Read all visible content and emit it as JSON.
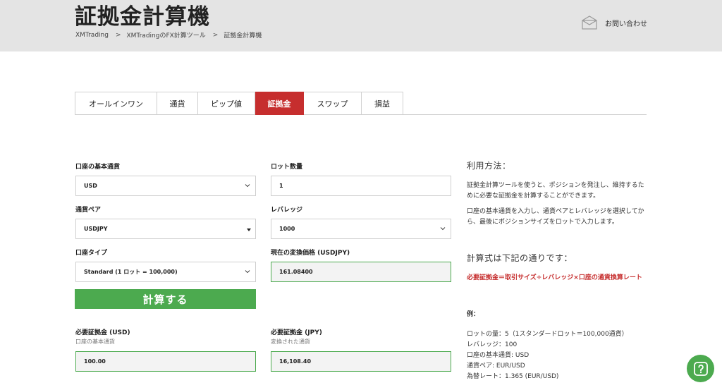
{
  "header": {
    "title": "証拠金計算機",
    "breadcrumb": [
      "XMTrading",
      "XMTradingのFX計算ツール",
      "証拠金計算機"
    ],
    "breadcrumb_separator": ">",
    "contact_label": "お問い合わせ",
    "contact_icon": "envelope-icon"
  },
  "tabs": [
    {
      "label": "オールインワン",
      "active": false
    },
    {
      "label": "通貨",
      "active": false
    },
    {
      "label": "ピップ値",
      "active": false
    },
    {
      "label": "証拠金",
      "active": true
    },
    {
      "label": "スワップ",
      "active": false
    },
    {
      "label": "損益",
      "active": false
    }
  ],
  "form": {
    "base_currency": {
      "label": "口座の基本通貨",
      "value": "USD"
    },
    "lot": {
      "label": "ロット数量",
      "value": "1"
    },
    "pair": {
      "label": "通貨ペア",
      "value": "USDJPY"
    },
    "leverage": {
      "label": "レバレッジ",
      "value": "1000"
    },
    "account_type": {
      "label": "口座タイプ",
      "value": "Standard (1 ロット = 100,000)"
    },
    "rate": {
      "label": "現在の変換価格 (USDJPY)",
      "value": "161.08400"
    },
    "calc_button": "計算する"
  },
  "results": {
    "margin_usd": {
      "label": "必要証拠金 (USD)",
      "sub": "口座の基本通貨",
      "value": "100.00"
    },
    "margin_jpy": {
      "label": "必要証拠金 (JPY)",
      "sub": "変換された通貨",
      "value": "16,108.40"
    }
  },
  "side": {
    "usage_title": "利用方法：",
    "usage_p1": "証拠金計算ツールを使うと、ポジションを発注し、維持するために必要な証拠金を計算することができます。",
    "usage_p2": "口座の基本通貨を入力し、通貨ペアとレバレッジを選択してから、最後にポジションサイズをロットで入力します。",
    "formula_title": "計算式は下記の通りです：",
    "formula": "必要証拠金＝取引サイズ÷レバレッジ×口座の通貨換算レート",
    "example_label": "例：",
    "example_lines": [
      "ロットの量：5（1スタンダードロット＝100,000通貨）",
      "レバレッジ：100",
      "口座の基本通貨: USD",
      "通貨ペア: EUR/USD",
      "為替レート：1.365 (EUR/USD)"
    ]
  },
  "help_icon": "question-icon",
  "colors": {
    "header_bg": "#e4e4e4",
    "active_tab": "#c62e2e",
    "button_green": "#4caa4f",
    "formula_red": "#c62e2e"
  }
}
